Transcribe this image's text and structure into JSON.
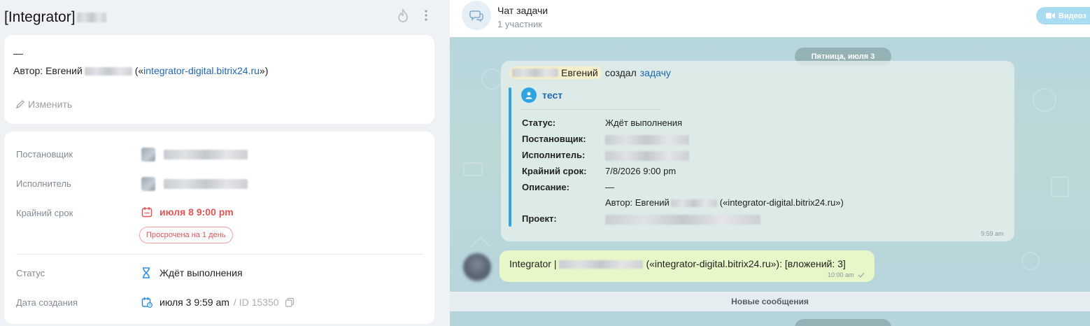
{
  "task": {
    "title": "[Integrator]",
    "description_dash": "—",
    "author_prefix": "Автор: Евгений",
    "author_paren_open": " («",
    "author_link": "integrator-digital.bitrix24.ru",
    "author_paren_close": "»)",
    "edit_label": "Изменить",
    "fields": {
      "creator_label": "Постановщик",
      "assignee_label": "Исполнитель",
      "deadline_label": "Крайний срок",
      "deadline_value": "июля 8 9:00 pm",
      "overdue_badge": "Просрочена на 1 день",
      "status_label": "Статус",
      "status_value": "Ждёт выполнения",
      "created_label": "Дата создания",
      "created_value": "июля 3 9:59 am",
      "id_value": "/ ID 15350"
    }
  },
  "chat": {
    "title": "Чат задачи",
    "subtitle": "1 участник",
    "video_button": "Видеоз",
    "date_divider": "Пятница, июля 3",
    "system_message": {
      "creator_name": "Евгений",
      "action_text": "создал",
      "action_link": "задачу",
      "task_name": "тест",
      "fields": [
        {
          "label": "Статус:",
          "value": "Ждёт выполнения"
        },
        {
          "label": "Постановщик:",
          "value": ""
        },
        {
          "label": "Исполнитель:",
          "value": ""
        },
        {
          "label": "Крайний срок:",
          "value": "7/8/2026 9:00 pm"
        },
        {
          "label": "Описание:",
          "value": "—"
        },
        {
          "label": "",
          "value": "Автор: Евгений"
        },
        {
          "label": "Проект:",
          "value": ""
        }
      ],
      "description_link_suffix": "(«integrator-digital.bitrix24.ru»)",
      "time": "9:59 am"
    },
    "message": {
      "text_prefix": "Integrator |",
      "text_suffix": "(«integrator-digital.bitrix24.ru»): [вложений: 3]",
      "time": "10:00 am"
    },
    "new_messages_label": "Новые сообщения"
  }
}
